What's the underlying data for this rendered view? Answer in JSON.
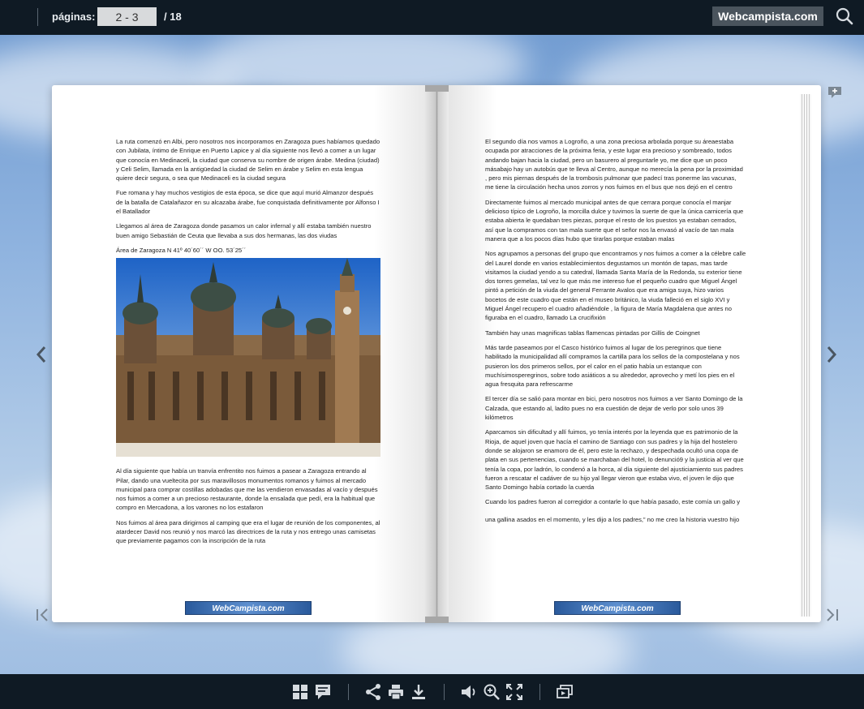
{
  "topbar": {
    "pages_label": "páginas:",
    "page_value": "2 - 3",
    "page_total": "/  18",
    "brand": "Webcampista.com"
  },
  "book": {
    "left_page": {
      "paragraphs": [
        "La ruta comenzó en Albi, pero nosotros nos incorporamos en Zaragoza pues habíamos quedado con Jubilata, íntimo de Enrique en Puerto Lapice y  al día siguiente nos llevó a comer a un lugar que conocía en Medinaceli, la  ciudad que conserva su nombre de origen árabe. Medina (ciudad) y Celi Selim, llamada en la antigüedad la ciudad de Selim en árabe y Selim en esta lengua quiere decir segura, o sea que Medinaceli es la ciudad segura",
        "Fue romana y hay muchos vestigios de esta época, se dice que aquí murió Almanzor después de la batalla de Catalañazor en su alcazaba árabe, fue conquistada definitivamente por Alfonso I el Batallador",
        "Llegamos al área de Zaragoza donde pasamos un calor infernal y allí estaba también nuestro buen amigo Sebastián de Ceuta que llevaba a sus dos hermanas, las dos viudas",
        "Área de Zaragoza  N 41º 40´60´´ W OO. 53´25´´"
      ],
      "paragraphs_after": [
        "Al día siguiente que había un tranvía enfrentito nos fuimos a pasear a Zaragoza entrando al Pilar, dando una vueltecita por sus maravillosos monumentos romanos y fuimos  al mercado municipal para comprar costillas adobadas que me las vendieron envasadas al vacío y después nos fuimos a comer a un precioso restaurante, donde la ensalada que pedí, era la habitual que compro en Mercadona, a los varones no los estafaron",
        "Nos fuimos al área para dirigirnos al camping que era el lugar de reunión de los componentes, al atardecer David nos reunió y nos marcó las directrices de la ruta y nos entrego unas camisetas que previamente pagamos con la inscripción de la ruta"
      ],
      "logo": "WebCampista.com"
    },
    "right_page": {
      "paragraphs": [
        "El segundo día  nos vamos a Logroño, a una zona preciosa arbolada porque su áreaestaba ocupada por  atracciones de la próxima feria, y este lugar era precioso y sombreado, todos andando bajan hacia la ciudad, pero un basurero al preguntarle yo, me dice que un poco másabajo hay un autobús que te lleva al Centro, aunque no merecía la pena por la proximidad , pero mis piernas después de la trombosis pulmonar que padecí tras  ponerme las vacunas, me tiene la circulación hecha unos zorros y nos fuimos en el bus que nos dejó en el centro",
        "Directamente  fuimos al mercado municipal antes de que cerrara porque conocía el manjar delicioso típico de Logroño, la morcilla dulce y tuvimos la suerte de que  la única carnicería que estaba abierta le quedaban tres piezas, porque el resto de los puestos ya estaban cerrados, así que la compramos con tan mala suerte que el señor nos la envasó al vacío de tan mala manera que a los pocos días hubo que tirarlas porque estaban  malas",
        "Nos agrupamos a  personas del grupo que encontramos y nos fuimos a comer  a  la célebre calle del Laurel donde en varios establecimientos degustamos un montón de tapas, mas tarde visitamos la ciudad yendo a su catedral, llamada Santa María de la Redonda, su exterior tiene dos torres gemelas, tal vez lo que más me intereso fue el pequeño cuadro que Miguel Ángel pintó a petición de la viuda del general Ferrante Avalos que era amiga suya, hizo varios bocetos de este cuadro que están en el museo británico, la viuda falleció en el siglo XVI y Miguel Ángel recupero el cuadro añadiéndole , la figura de María Magdalena que antes no figuraba en el cuadro, llamado La crucifixión",
        "También hay unas magnificas tablas flamencas pintadas por Gillis de Coingnet",
        "Más tarde paseamos por el Casco histórico  fuimos al  lugar de los peregrinos que tiene habilitado  la municipalidad allí compramos la cartilla para los sellos de la compostelana y nos pusieron los dos primeros sellos, por el calor en el patio había un estanque con muchísimosperegrinos, sobre todo asiáticos a su alrededor, aprovecho y metí los pies en el agua fresquita para refrescarme",
        "El tercer día  se salió para montar en bici, pero nosotros nos fuimos a ver Santo Domingo de la Calzada, que estando al, ladito pues no era cuestión de dejar de verlo por solo unos 39 kilómetros",
        "Aparcamos sin dificultad y allí fuimos,  yo tenía interés por la leyenda que es patrimonio de la Rioja, de aquel joven que hacía el camino de Santiago con sus padres y la hija del hostelero donde se alojaron se enamoro de él, pero este la rechazo, y despechada ocultó una copa de plata en sus pertenencias, cuando se marchaban del hotel, lo denunció9 y la justicia al ver que tenía la copa, por ladrón, lo condenó a la horca, al día siguiente del ajusticiamiento sus padres fueron a rescatar el cadáver de su hijo yal llegar vieron que estaba vivo, el joven le dijo que Santo Domingo había cortado la cuerda",
        "Cuando los padres fueron al corregidor a contarle lo que había pasado, este comía un gallo y",
        "una gallina asados en el momento, y les dijo a los padres,” no me creo la historia vuestro hijo"
      ],
      "logo": "WebCampista.com"
    }
  },
  "icons": {
    "search": "search-icon",
    "prev": "chevron-left-icon",
    "next": "chevron-right-icon",
    "first": "first-page-icon",
    "last": "last-page-icon",
    "bookmark": "add-bookmark-icon"
  },
  "colors": {
    "bar": "#0f1a24",
    "brand_bg": "#4a545d",
    "icon": "#d6dbe0"
  }
}
